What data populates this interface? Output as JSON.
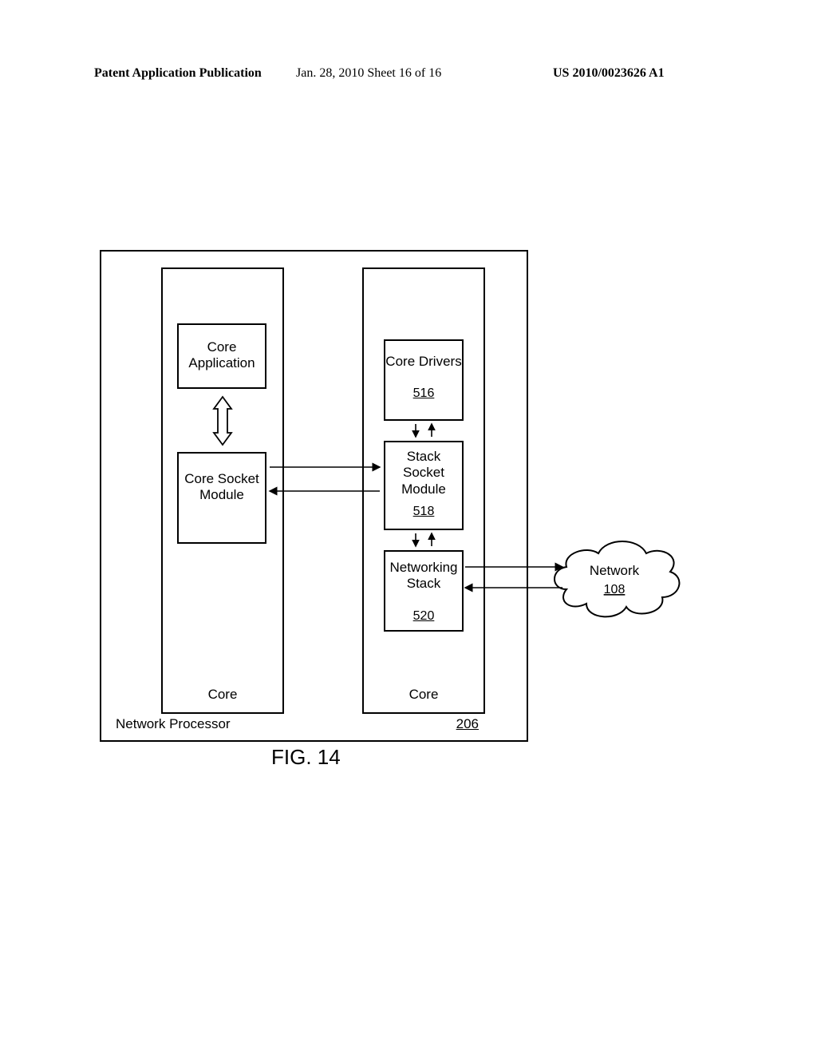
{
  "header": {
    "left": "Patent Application Publication",
    "middle": "Jan. 28, 2010  Sheet 16 of 16",
    "right": "US 2010/0023626 A1"
  },
  "outer": {
    "label": "Network Processor",
    "ref": "206"
  },
  "core_left": {
    "label": "Core",
    "app": "Core Application",
    "sock": "Core Socket Module"
  },
  "core_right": {
    "label": "Core",
    "drivers": {
      "title": "Core Drivers",
      "ref": "516"
    },
    "stack_sock": {
      "title": "Stack Socket Module",
      "ref": "518"
    },
    "net_stack": {
      "title": "Networking Stack",
      "ref": "520"
    }
  },
  "cloud": {
    "title": "Network",
    "ref": "108"
  },
  "figure": "FIG. 14"
}
